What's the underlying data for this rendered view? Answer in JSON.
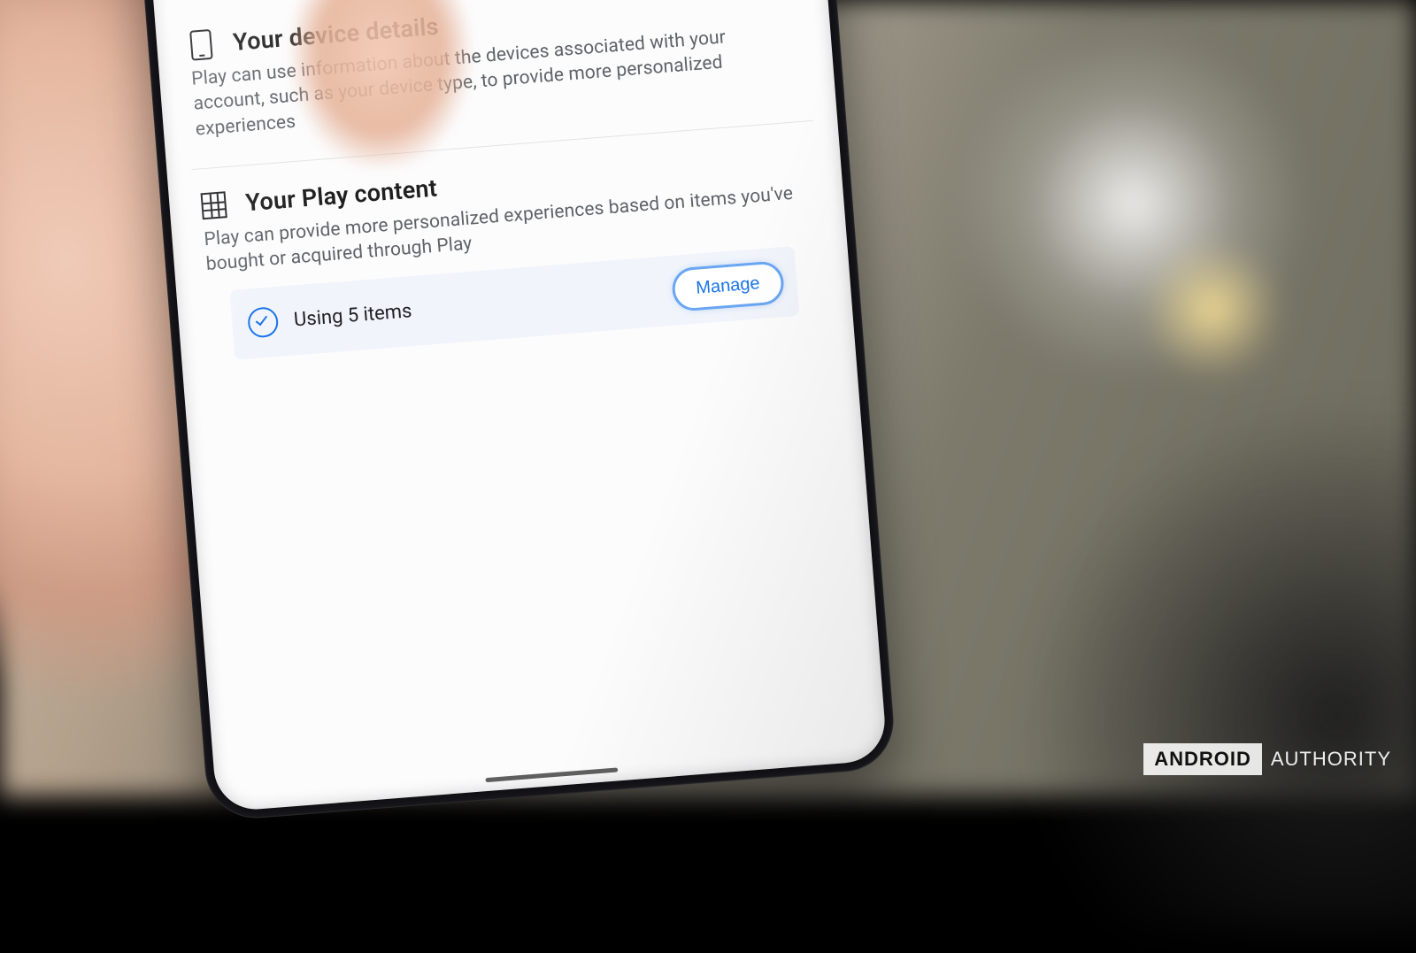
{
  "sections": {
    "device": {
      "title": "Your device details",
      "description": "Play can use information about the devices associated with your account, such as your device type, to provide more personalized experiences"
    },
    "playContent": {
      "title": "Your Play content",
      "description": "Play can provide more personalized experiences based on items you've bought or acquired through Play",
      "status": "Using 5 items",
      "manage": "Manage"
    }
  },
  "watermark": {
    "brand1": "ANDROID",
    "brand2": "AUTHORITY"
  },
  "colors": {
    "accent": "#1a73e8",
    "textSecondary": "#5f6368",
    "statusBg": "#f1f5fb"
  }
}
